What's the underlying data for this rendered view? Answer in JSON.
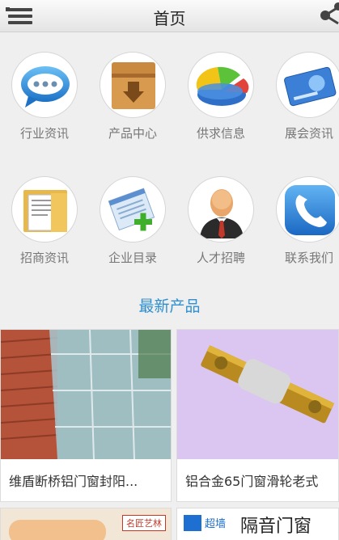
{
  "header": {
    "title": "首页",
    "menu_icon": "menu-icon",
    "share_icon": "share-icon"
  },
  "categories": [
    {
      "label": "行业资讯",
      "icon": "chat-bubble-icon"
    },
    {
      "label": "产品中心",
      "icon": "box-icon"
    },
    {
      "label": "供求信息",
      "icon": "pie-chart-icon"
    },
    {
      "label": "展会资讯",
      "icon": "card-icon"
    },
    {
      "label": "招商资讯",
      "icon": "folder-icon"
    },
    {
      "label": "企业目录",
      "icon": "notepad-add-icon"
    },
    {
      "label": "人才招聘",
      "icon": "person-icon"
    },
    {
      "label": "联系我们",
      "icon": "phone-icon"
    }
  ],
  "section": {
    "title": "最新产品"
  },
  "products": [
    {
      "name": "维盾断桥铝门窗封阳..."
    },
    {
      "name": "铝合金65门窗滑轮老式"
    },
    {
      "name": "",
      "badge": "名匠艺林"
    },
    {
      "name": "",
      "badge": "超墙",
      "heading": "隔音门窗"
    }
  ],
  "colors": {
    "accent": "#2f8fd0",
    "background": "#efefef"
  }
}
